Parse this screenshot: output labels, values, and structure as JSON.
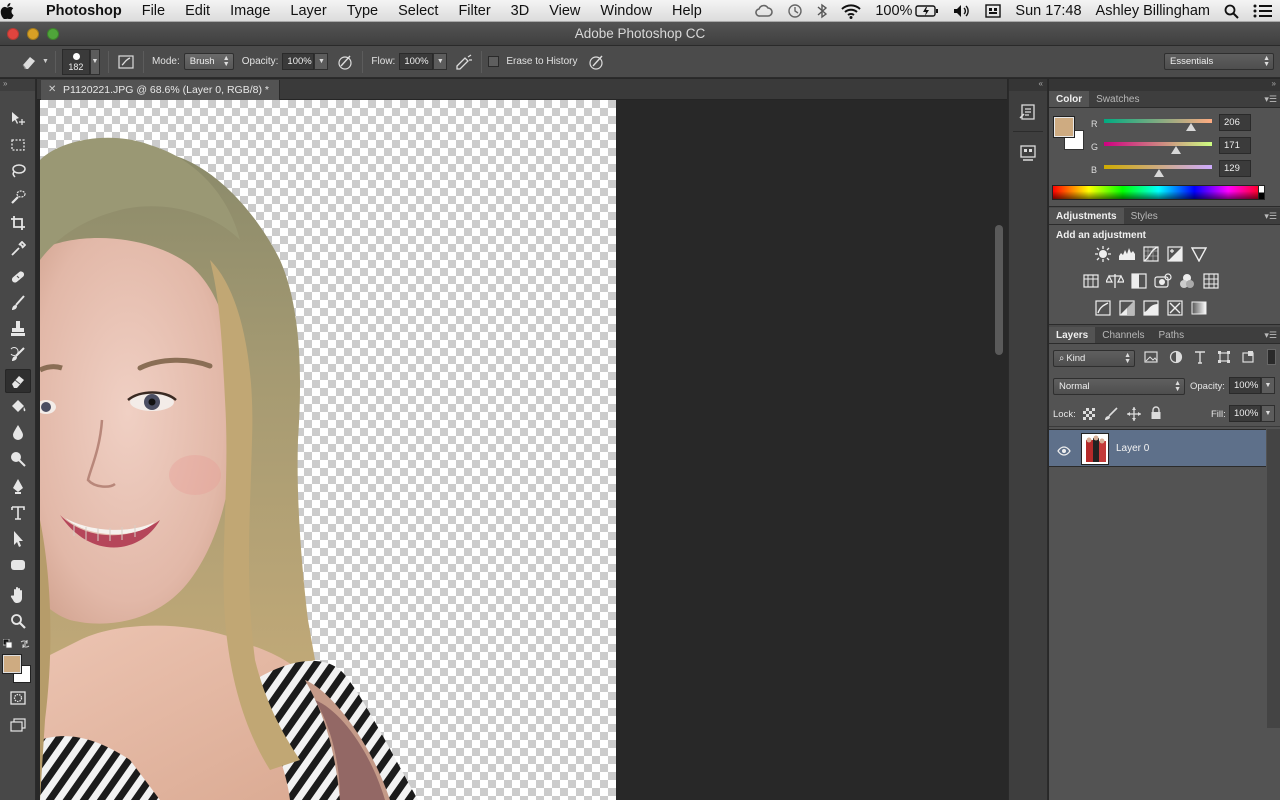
{
  "menubar": {
    "app": "Photoshop",
    "items": [
      "File",
      "Edit",
      "Image",
      "Layer",
      "Type",
      "Select",
      "Filter",
      "3D",
      "View",
      "Window",
      "Help"
    ],
    "battery": "100%",
    "clock": "Sun 17:48",
    "user": "Ashley Billingham"
  },
  "window": {
    "title": "Adobe Photoshop CC"
  },
  "options": {
    "brush_size": "182",
    "mode_label": "Mode:",
    "mode_value": "Brush",
    "opacity_label": "Opacity:",
    "opacity_value": "100%",
    "flow_label": "Flow:",
    "flow_value": "100%",
    "erase_history_label": "Erase to History",
    "workspace": "Essentials"
  },
  "document": {
    "tab_title": "P1120221.JPG @ 68.6% (Layer 0, RGB/8) *"
  },
  "color_panel": {
    "tabs": [
      "Color",
      "Swatches"
    ],
    "foreground": "#ceab81",
    "background": "#ffffff",
    "channels": [
      {
        "key": "R",
        "value": "206"
      },
      {
        "key": "G",
        "value": "171"
      },
      {
        "key": "B",
        "value": "129"
      }
    ]
  },
  "adjustments_panel": {
    "tabs": [
      "Adjustments",
      "Styles"
    ],
    "title": "Add an adjustment"
  },
  "layers_panel": {
    "tabs": [
      "Layers",
      "Channels",
      "Paths"
    ],
    "filter_kind": "Kind",
    "blend_mode": "Normal",
    "opacity_label": "Opacity:",
    "opacity_value": "100%",
    "lock_label": "Lock:",
    "fill_label": "Fill:",
    "fill_value": "100%",
    "layers": [
      {
        "name": "Layer 0"
      }
    ]
  }
}
